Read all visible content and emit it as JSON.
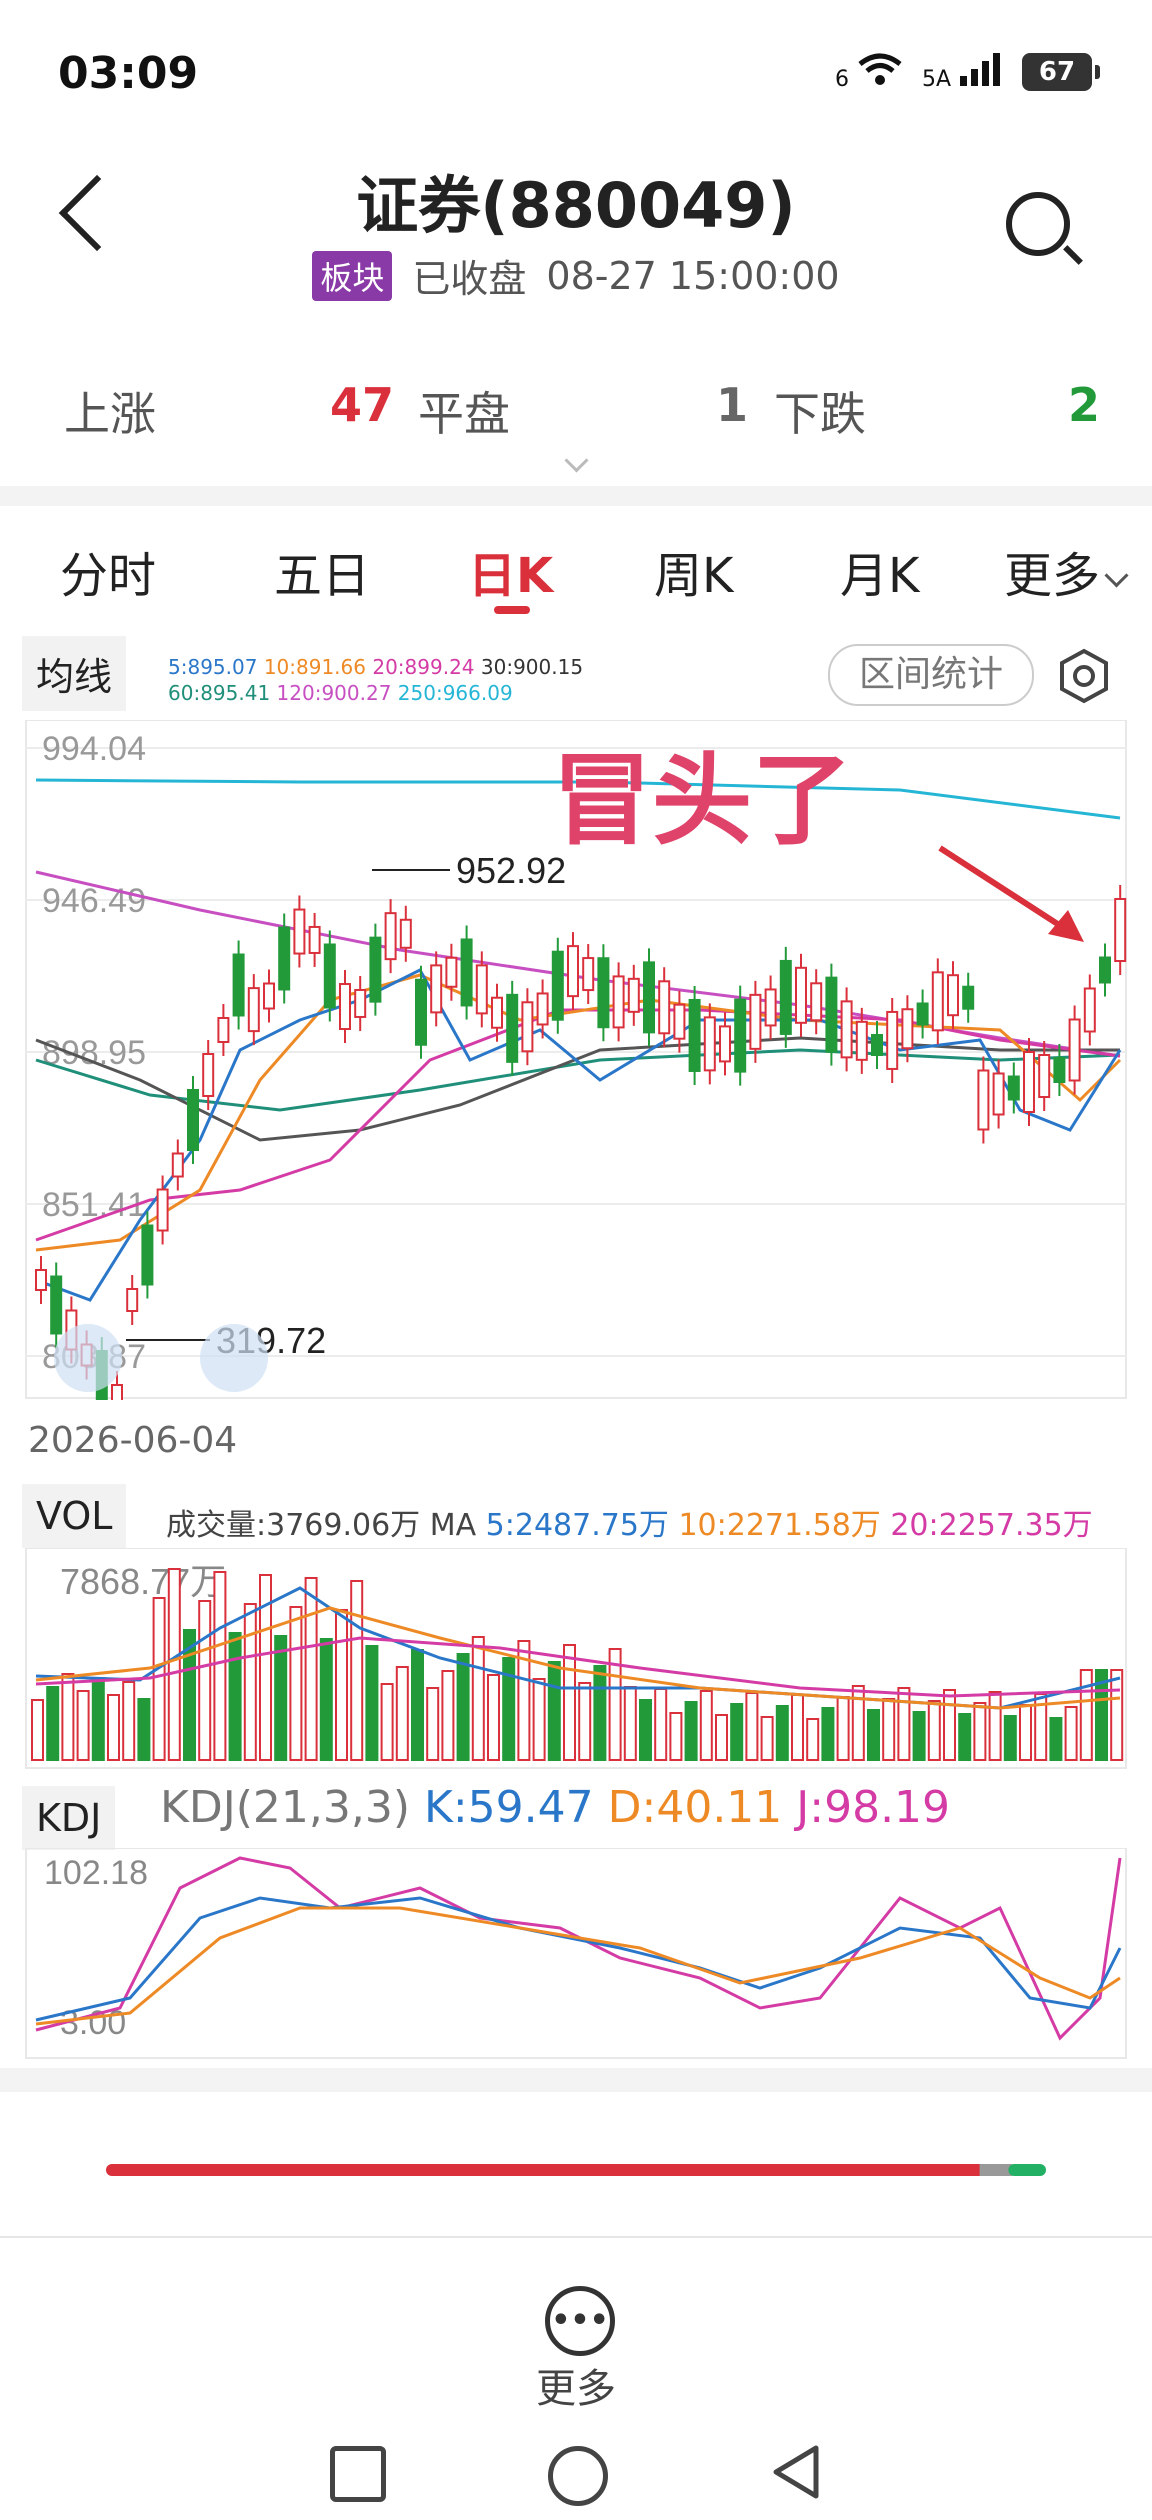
{
  "status": {
    "time": "03:09",
    "net1": "6",
    "net2": "5A",
    "battery": "67"
  },
  "header": {
    "title": "证券(880049)",
    "badge": "板块",
    "state": "已收盘",
    "datetime": "08-27  15:00:00"
  },
  "breadth": {
    "up_label": "上涨",
    "up_count": "47",
    "flat_label": "平盘",
    "flat_count": "1",
    "down_label": "下跌",
    "down_count": "2"
  },
  "tabs": [
    {
      "label": "分时"
    },
    {
      "label": "五日"
    },
    {
      "label": "日K"
    },
    {
      "label": "周K"
    },
    {
      "label": "月K"
    },
    {
      "label": "更多"
    }
  ],
  "ma": {
    "label": "均线",
    "row1": [
      {
        "text": "5:895.07",
        "color": "#2a77c9"
      },
      {
        "text": "10:891.66",
        "color": "#ee8a25"
      },
      {
        "text": "20:899.24",
        "color": "#d43ba5"
      },
      {
        "text": "30:900.15",
        "color": "#333333"
      }
    ],
    "row2": [
      {
        "text": "60:895.41",
        "color": "#1f8f7a"
      },
      {
        "text": "120:900.27",
        "color": "#c74fc2"
      },
      {
        "text": "250:966.09",
        "color": "#25b6d6"
      }
    ],
    "range_button": "区间统计",
    "settings_icon": "hexagon-settings-icon"
  },
  "kline": {
    "y_labels": [
      "994.04",
      "946.49",
      "898.95",
      "851.41",
      "803.87"
    ],
    "high_marker": "952.92",
    "low_marker": "319.72",
    "annotation": "冒头了",
    "start_date": "2026-06-04"
  },
  "vol": {
    "label": "VOL",
    "info": [
      {
        "text": "成交量:3769.06万 MA ",
        "color": "#444444"
      },
      {
        "text": "5:2487.75万 ",
        "color": "#2a77c9"
      },
      {
        "text": "10:2271.58万 ",
        "color": "#ee8a25"
      },
      {
        "text": "20:2257.35万",
        "color": "#d43ba5"
      }
    ],
    "y_label": "7868.77万"
  },
  "kdj": {
    "label": "KDJ",
    "info": [
      {
        "text": "KDJ(21,3,3) ",
        "color": "#777777"
      },
      {
        "text": "K:59.47 ",
        "color": "#2a77c9"
      },
      {
        "text": "D:40.11 ",
        "color": "#ee8a25"
      },
      {
        "text": "J:98.19",
        "color": "#d43ba5"
      }
    ],
    "y_top": "102.18",
    "y_bottom": "3.00"
  },
  "progress": {
    "up_fraction": 0.94,
    "flat_fraction": 0.02,
    "down_fraction": 0.04,
    "up_color": "#d9303b",
    "flat_color": "#999999",
    "down_color": "#22b065"
  },
  "bottom": {
    "more_label": "更多"
  },
  "colors": {
    "rise": "#d9303b",
    "fall": "#229a3a"
  }
}
